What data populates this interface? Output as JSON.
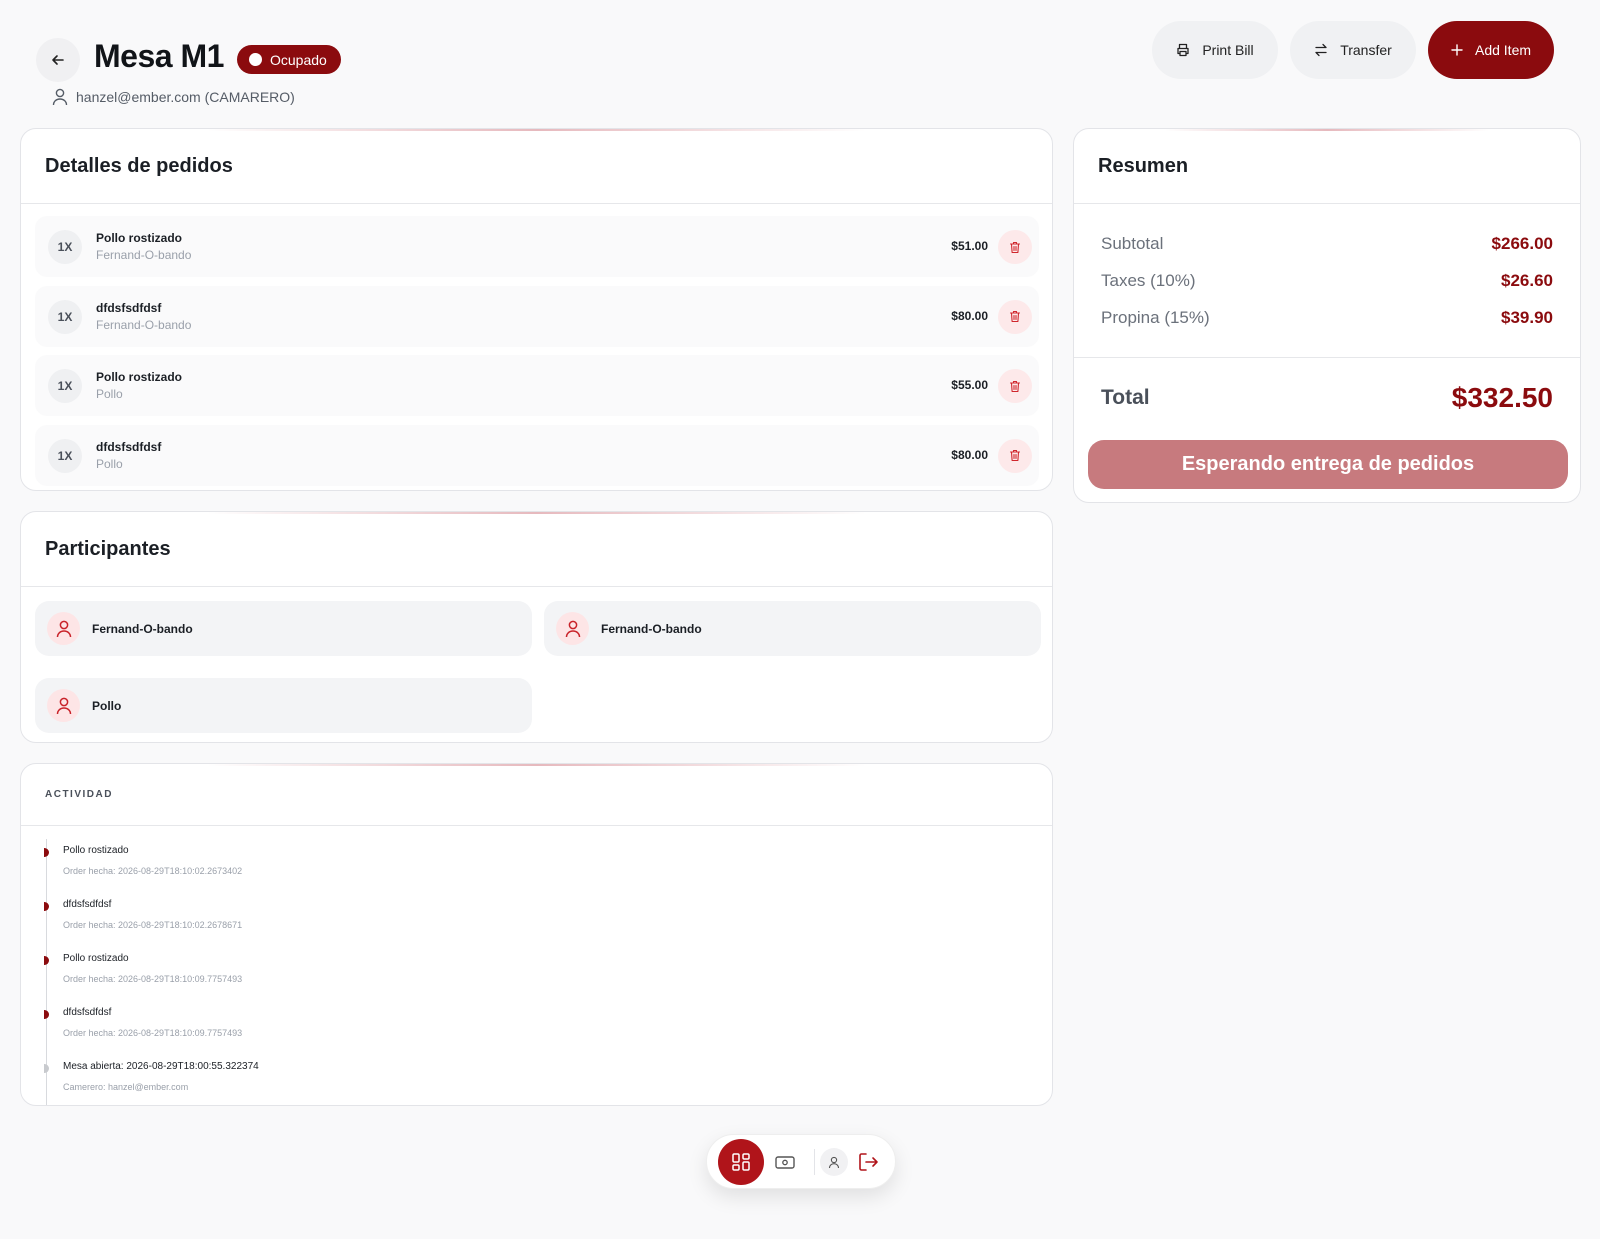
{
  "header": {
    "title": "Mesa M1",
    "status": "Ocupado",
    "waiter": "hanzel@ember.com (CAMARERO)",
    "print_label": "Print Bill",
    "transfer_label": "Transfer",
    "add_label": "Add Item"
  },
  "orders": {
    "title": "Detalles de pedidos",
    "items": [
      {
        "qty": "1X",
        "name": "Pollo rostizado",
        "owner": "Fernand-O-bando",
        "price": "$51.00"
      },
      {
        "qty": "1X",
        "name": "dfdsfsdfdsf",
        "owner": "Fernand-O-bando",
        "price": "$80.00"
      },
      {
        "qty": "1X",
        "name": "Pollo rostizado",
        "owner": "Pollo",
        "price": "$55.00"
      },
      {
        "qty": "1X",
        "name": "dfdsfsdfdsf",
        "owner": "Pollo",
        "price": "$80.00"
      }
    ]
  },
  "participants": {
    "title": "Participantes",
    "items": [
      {
        "name": "Fernand-O-bando"
      },
      {
        "name": "Fernand-O-bando"
      },
      {
        "name": "Pollo"
      }
    ]
  },
  "activity": {
    "title": "ACTIVIDAD",
    "items": [
      {
        "name": "Pollo rostizado",
        "meta": "Order hecha: 2026-08-29T18:10:02.2673402"
      },
      {
        "name": "dfdsfsdfdsf",
        "meta": "Order hecha: 2026-08-29T18:10:02.2678671"
      },
      {
        "name": "Pollo rostizado",
        "meta": "Order hecha: 2026-08-29T18:10:09.7757493"
      },
      {
        "name": "dfdsfsdfdsf",
        "meta": "Order hecha: 2026-08-29T18:10:09.7757493"
      },
      {
        "name": "Mesa abierta: 2026-08-29T18:00:55.322374",
        "meta": "Camerero: hanzel@ember.com"
      }
    ]
  },
  "summary": {
    "title": "Resumen",
    "subtotal_label": "Subtotal",
    "subtotal_value": "$266.00",
    "taxes_label": "Taxes (10%)",
    "taxes_value": "$26.60",
    "tip_label": "Propina (15%)",
    "tip_value": "$39.90",
    "total_label": "Total",
    "total_value": "$332.50",
    "action_label": "Esperando entrega de pedidos"
  },
  "colors": {
    "accent": "#8b0b0e",
    "button_disabled": "#c77a7e"
  }
}
